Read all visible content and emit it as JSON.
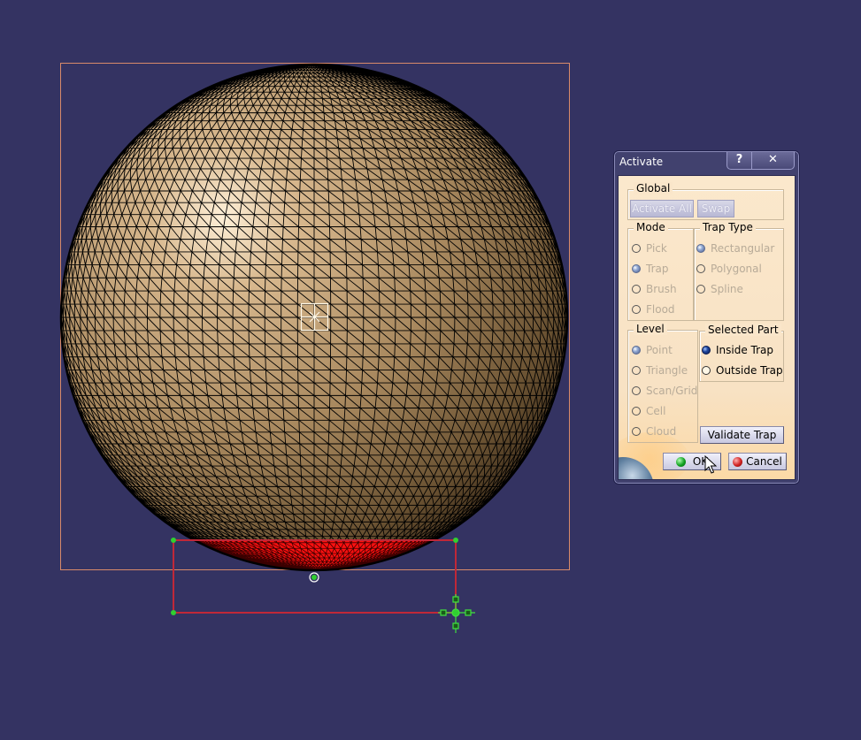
{
  "viewport": {
    "background_color": "#343362",
    "object": {
      "type": "tessellated-sphere",
      "surface_color": "#b08d62",
      "mesh_color": "#000000",
      "selected_region_color": "#ff1010"
    },
    "bounding_box_color": "#d88a6a",
    "trap_rectangle_color": "#c02838",
    "handle_color": "#30d030",
    "compass_icon": "crosshair-square-icon",
    "manipulator_icon": "move-cross-icon"
  },
  "dialog": {
    "title": "Activate",
    "help_label": "?",
    "close_label": "✕",
    "global": {
      "label": "Global",
      "activate_all_label": "Activate All",
      "swap_label": "Swap"
    },
    "mode": {
      "label": "Mode",
      "options": [
        {
          "label": "Pick",
          "checked": false
        },
        {
          "label": "Trap",
          "checked": true
        },
        {
          "label": "Brush",
          "checked": false
        },
        {
          "label": "Flood",
          "checked": false
        }
      ]
    },
    "trap_type": {
      "label": "Trap Type",
      "options": [
        {
          "label": "Rectangular",
          "checked": true
        },
        {
          "label": "Polygonal",
          "checked": false
        },
        {
          "label": "Spline",
          "checked": false
        }
      ]
    },
    "level": {
      "label": "Level",
      "options": [
        {
          "label": "Point",
          "checked": true
        },
        {
          "label": "Triangle",
          "checked": false
        },
        {
          "label": "Scan/Grid",
          "checked": false
        },
        {
          "label": "Cell",
          "checked": false
        },
        {
          "label": "Cloud",
          "checked": false
        }
      ]
    },
    "selected_part": {
      "label": "Selected Part",
      "options": [
        {
          "label": "Inside Trap",
          "checked": true
        },
        {
          "label": "Outside Trap",
          "checked": false
        }
      ]
    },
    "validate_trap_label": "Validate Trap",
    "ok_label": "OK",
    "cancel_label": "Cancel"
  }
}
